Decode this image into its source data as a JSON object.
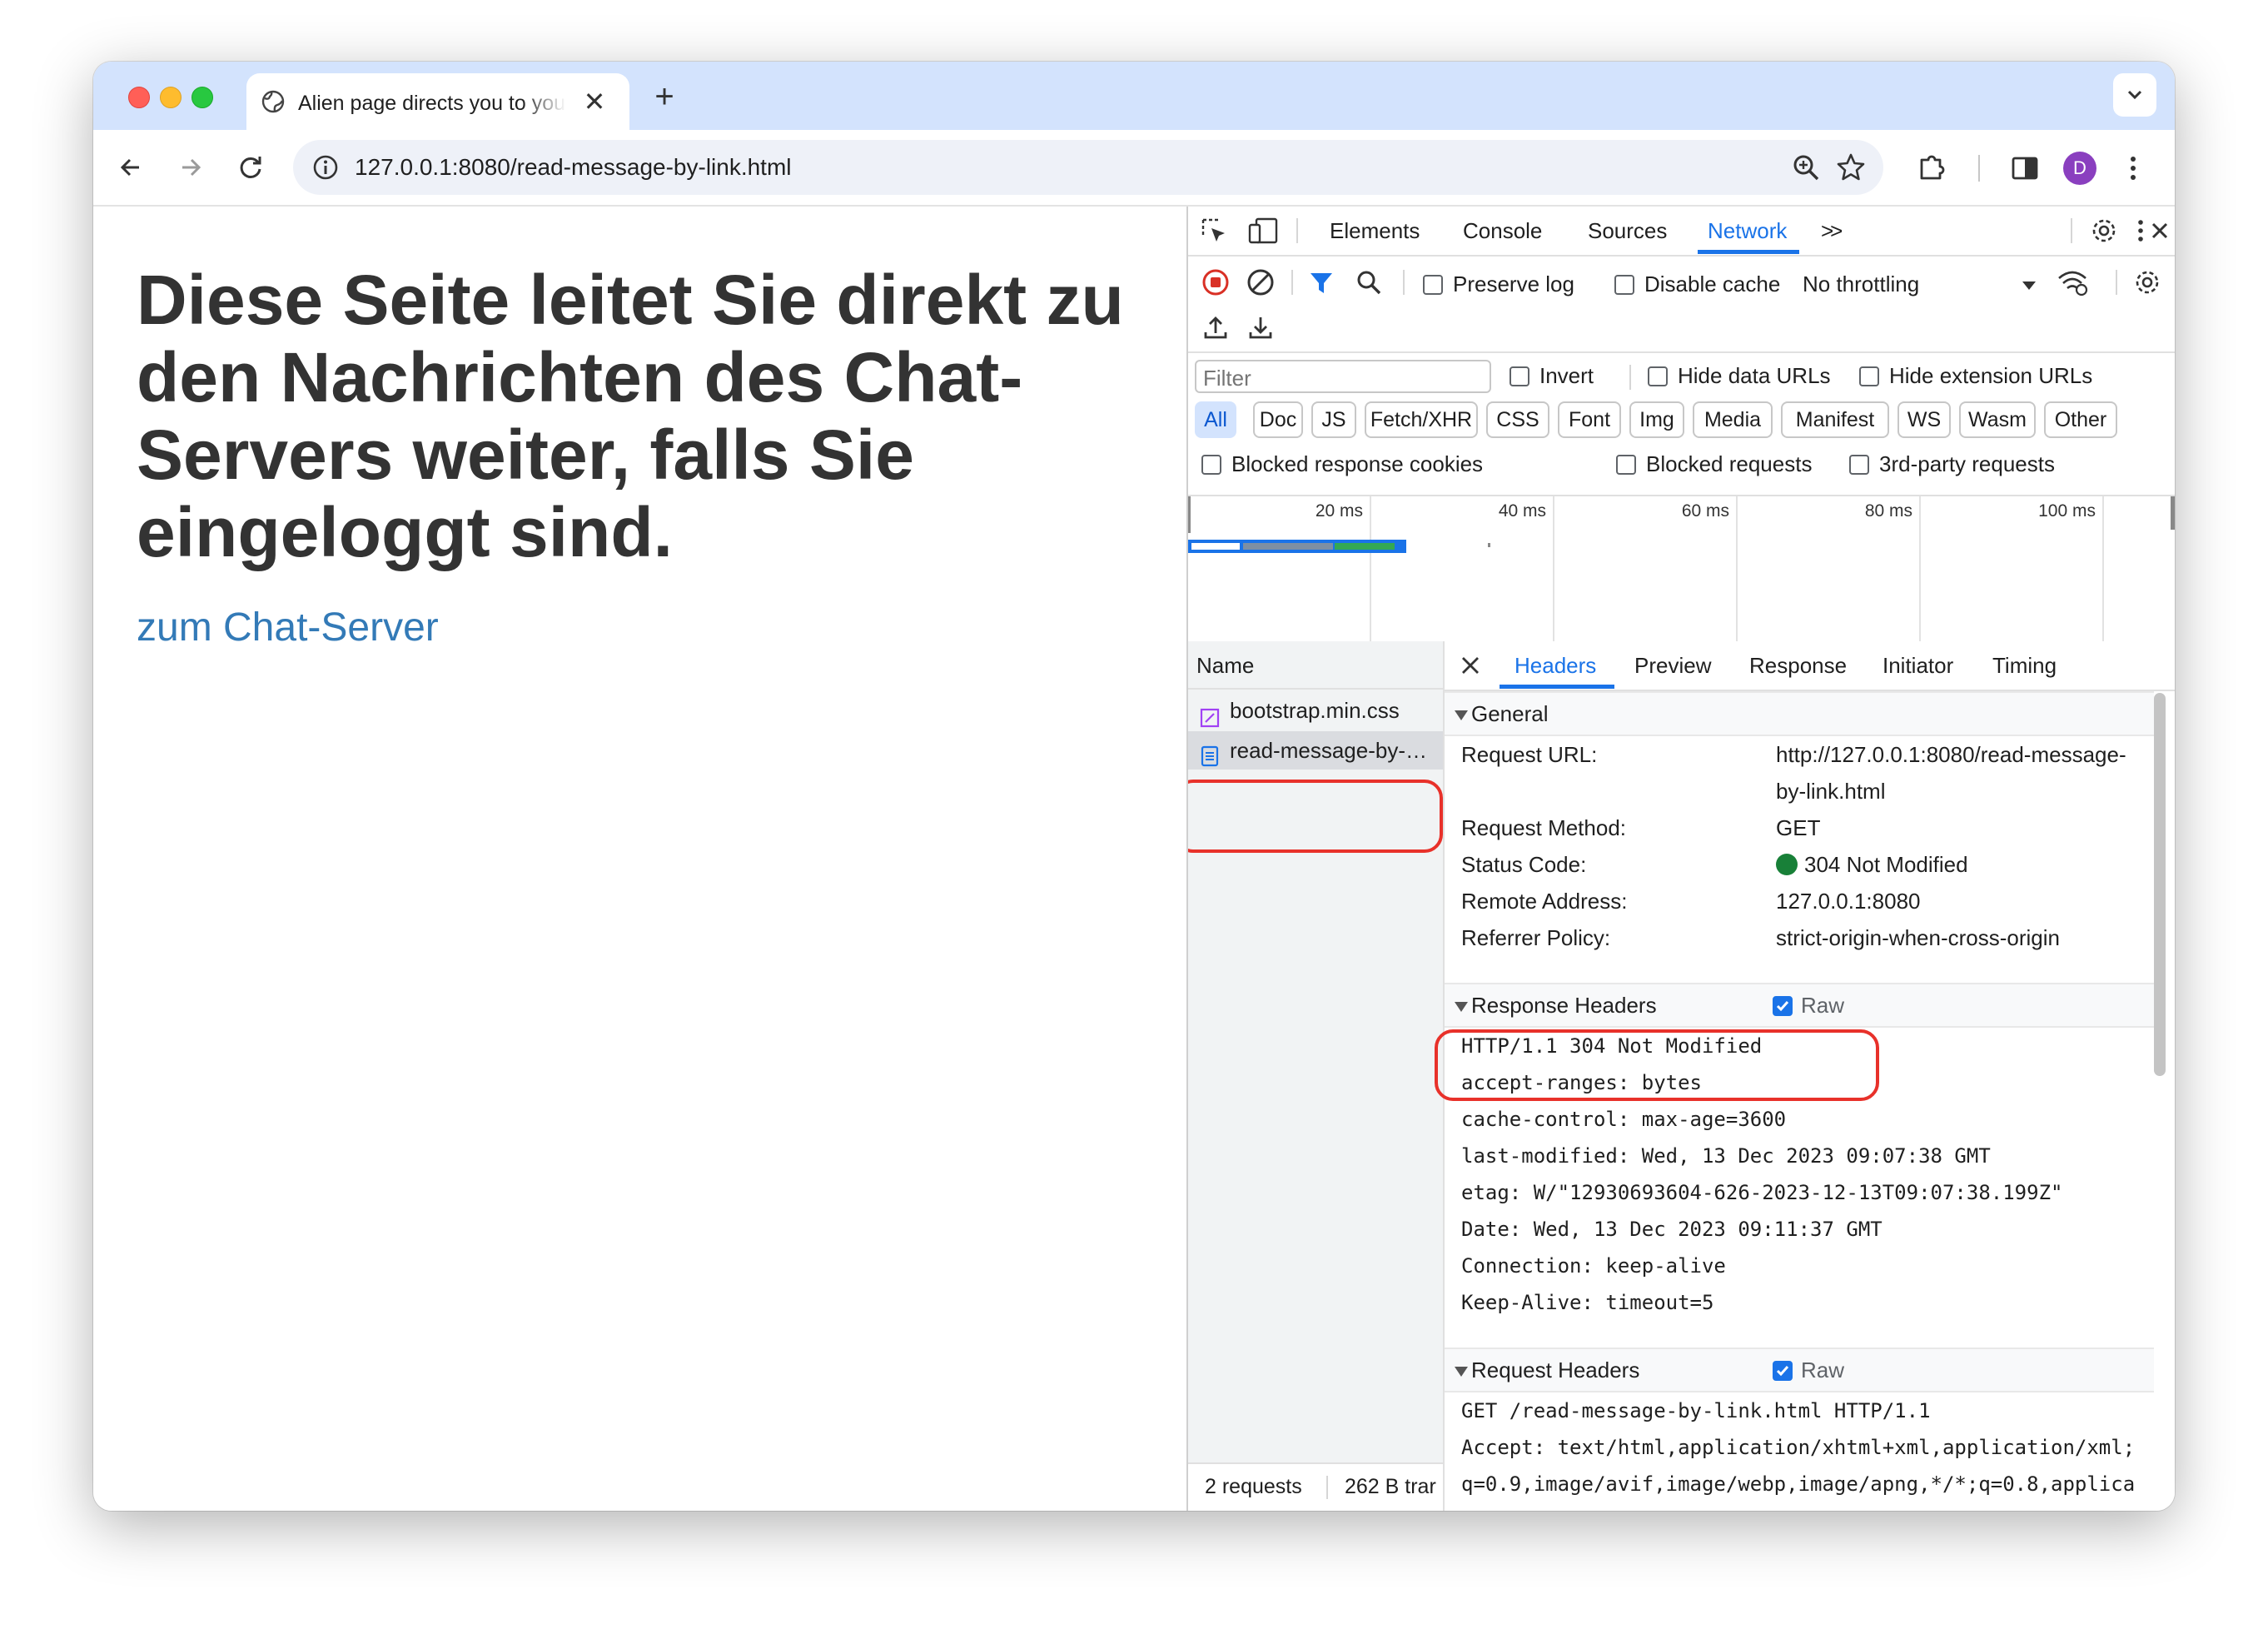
{
  "browser": {
    "tab_title": "Alien page directs you to your",
    "tab_close": "✕",
    "new_tab": "+",
    "url": "127.0.0.1:8080/read-message-by-link.html",
    "profile_initial": "D"
  },
  "page": {
    "heading": "Diese Seite leitet Sie direkt zu den Nachrichten des Chat-Servers weiter, falls Sie eingeloggt sind.",
    "link_text": "zum Chat-Server",
    "link_color": "#337ab7"
  },
  "devtools": {
    "tabs": [
      "Elements",
      "Console",
      "Sources",
      "Network"
    ],
    "active_tab": "Network",
    "more_tabs": ">>",
    "toolbar": {
      "preserve_log": "Preserve log",
      "disable_cache": "Disable cache",
      "throttling": "No throttling"
    },
    "filter": {
      "placeholder": "Filter",
      "invert": "Invert",
      "hide_data_urls": "Hide data URLs",
      "hide_extension_urls": "Hide extension URLs",
      "types": [
        "All",
        "Doc",
        "JS",
        "Fetch/XHR",
        "CSS",
        "Font",
        "Img",
        "Media",
        "Manifest",
        "WS",
        "Wasm",
        "Other"
      ],
      "selected_type": "All",
      "blocked_response_cookies": "Blocked response cookies",
      "blocked_requests": "Blocked requests",
      "third_party": "3rd-party requests"
    },
    "overview": {
      "ticks": [
        "20 ms",
        "40 ms",
        "60 ms",
        "80 ms",
        "100 ms"
      ]
    },
    "requests": {
      "column": "Name",
      "items": [
        "bootstrap.min.css",
        "read-message-by-…"
      ],
      "selected": "read-message-by-…",
      "summary_count": "2 requests",
      "summary_size": "262 B trar"
    },
    "detail": {
      "tabs": [
        "Headers",
        "Preview",
        "Response",
        "Initiator",
        "Timing"
      ],
      "active_tab": "Headers",
      "general": {
        "title": "General",
        "rows": [
          {
            "key": "Request URL:",
            "value": "http://127.0.0.1:8080/read-message-",
            "value2": "by-link.html"
          },
          {
            "key": "Request Method:",
            "value": "GET"
          },
          {
            "key": "Status Code:",
            "value": "304 Not Modified"
          },
          {
            "key": "Remote Address:",
            "value": "127.0.0.1:8080"
          },
          {
            "key": "Referrer Policy:",
            "value": "strict-origin-when-cross-origin"
          }
        ]
      },
      "response_headers": {
        "title": "Response Headers",
        "raw_label": "Raw",
        "raw_checked": true,
        "lines": [
          "HTTP/1.1 304 Not Modified",
          "accept-ranges: bytes",
          "cache-control: max-age=3600",
          "last-modified: Wed, 13 Dec 2023 09:07:38 GMT",
          "etag: W/\"12930693604-626-2023-12-13T09:07:38.199Z\"",
          "Date: Wed, 13 Dec 2023 09:11:37 GMT",
          "Connection: keep-alive",
          "Keep-Alive: timeout=5"
        ]
      },
      "request_headers": {
        "title": "Request Headers",
        "raw_label": "Raw",
        "raw_checked": true,
        "lines": [
          "GET /read-message-by-link.html HTTP/1.1",
          "Accept: text/html,application/xhtml+xml,application/xml;",
          "q=0.9,image/avif,image/webp,image/apng,*/*;q=0.8,applica"
        ]
      }
    }
  },
  "colors": {
    "accent": "#1a73e8",
    "status_ok": "#188038",
    "highlight_box": "#e8312a"
  }
}
